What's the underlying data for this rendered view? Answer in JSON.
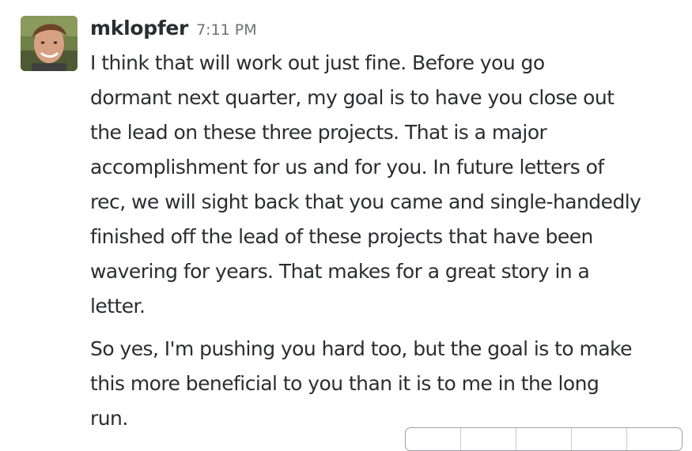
{
  "message": {
    "username": "mklopfer",
    "timestamp": "7:11 PM",
    "paragraphs": [
      {
        "lines": [
          "I think that will work out just fine.  Before you go",
          "dormant next quarter, my goal is to have you close out",
          "the lead on these three projects. That is a major",
          "accomplishment for us and for you. In future letters of",
          "rec, we will sight back that you came and single-handedly",
          "finished off the lead of these projects that have been",
          "wavering for years. That makes for a great story in a",
          "letter."
        ]
      },
      {
        "lines": [
          "So yes, I'm pushing you hard too, but the goal is to make",
          "this more beneficial to you than it is to me in the long",
          "run."
        ]
      }
    ]
  },
  "message_actions": {
    "icons": [
      "reaction-icon",
      "reply-icon",
      "share-icon",
      "star-icon",
      "more-icon"
    ]
  }
}
